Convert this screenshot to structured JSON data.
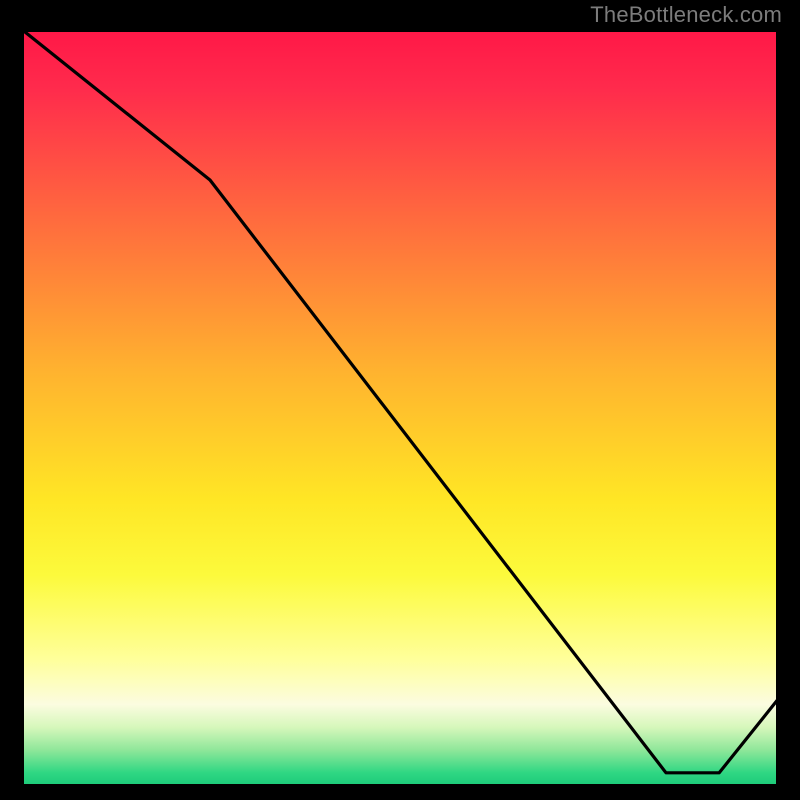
{
  "attribution": "TheBottleneck.com",
  "annotation_text": "",
  "chart_data": {
    "type": "line",
    "title": "",
    "xlabel": "",
    "ylabel": "",
    "xlim": [
      0,
      100
    ],
    "ylim": [
      0,
      100
    ],
    "x": [
      0,
      25,
      85,
      92,
      100
    ],
    "y": [
      100,
      80,
      2,
      2,
      12
    ],
    "annotations": [
      {
        "x": 86,
        "y": 4,
        "text": ""
      }
    ],
    "background_gradient": {
      "top": "#ff1747",
      "mid": "#ffe625",
      "bottom": "#18c877"
    }
  }
}
